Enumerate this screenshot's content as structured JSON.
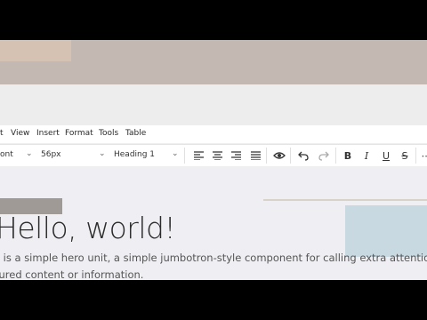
{
  "menu": {
    "items": [
      "t",
      "View",
      "Insert",
      "Format",
      "Tools",
      "Table"
    ]
  },
  "toolbar": {
    "font_family": "ont",
    "font_size": "56px",
    "block_format": "Heading 1",
    "icons": [
      "align-left-icon",
      "align-center-icon",
      "align-right-icon",
      "align-justify-icon",
      "preview-icon",
      "undo-icon",
      "redo-icon",
      "bold-icon",
      "italic-icon",
      "underline-icon",
      "strikethrough-icon",
      "more-icon"
    ]
  },
  "content": {
    "heading": "Hello, world!",
    "lead_line1": "s is a simple hero unit, a simple jumbotron-style component for calling extra attention to",
    "lead_line2": "tured content or information."
  },
  "colors": {
    "top_band": "#c3b8b2",
    "blue_block": "#c8d9e2",
    "gray_block": "#a09a96"
  }
}
